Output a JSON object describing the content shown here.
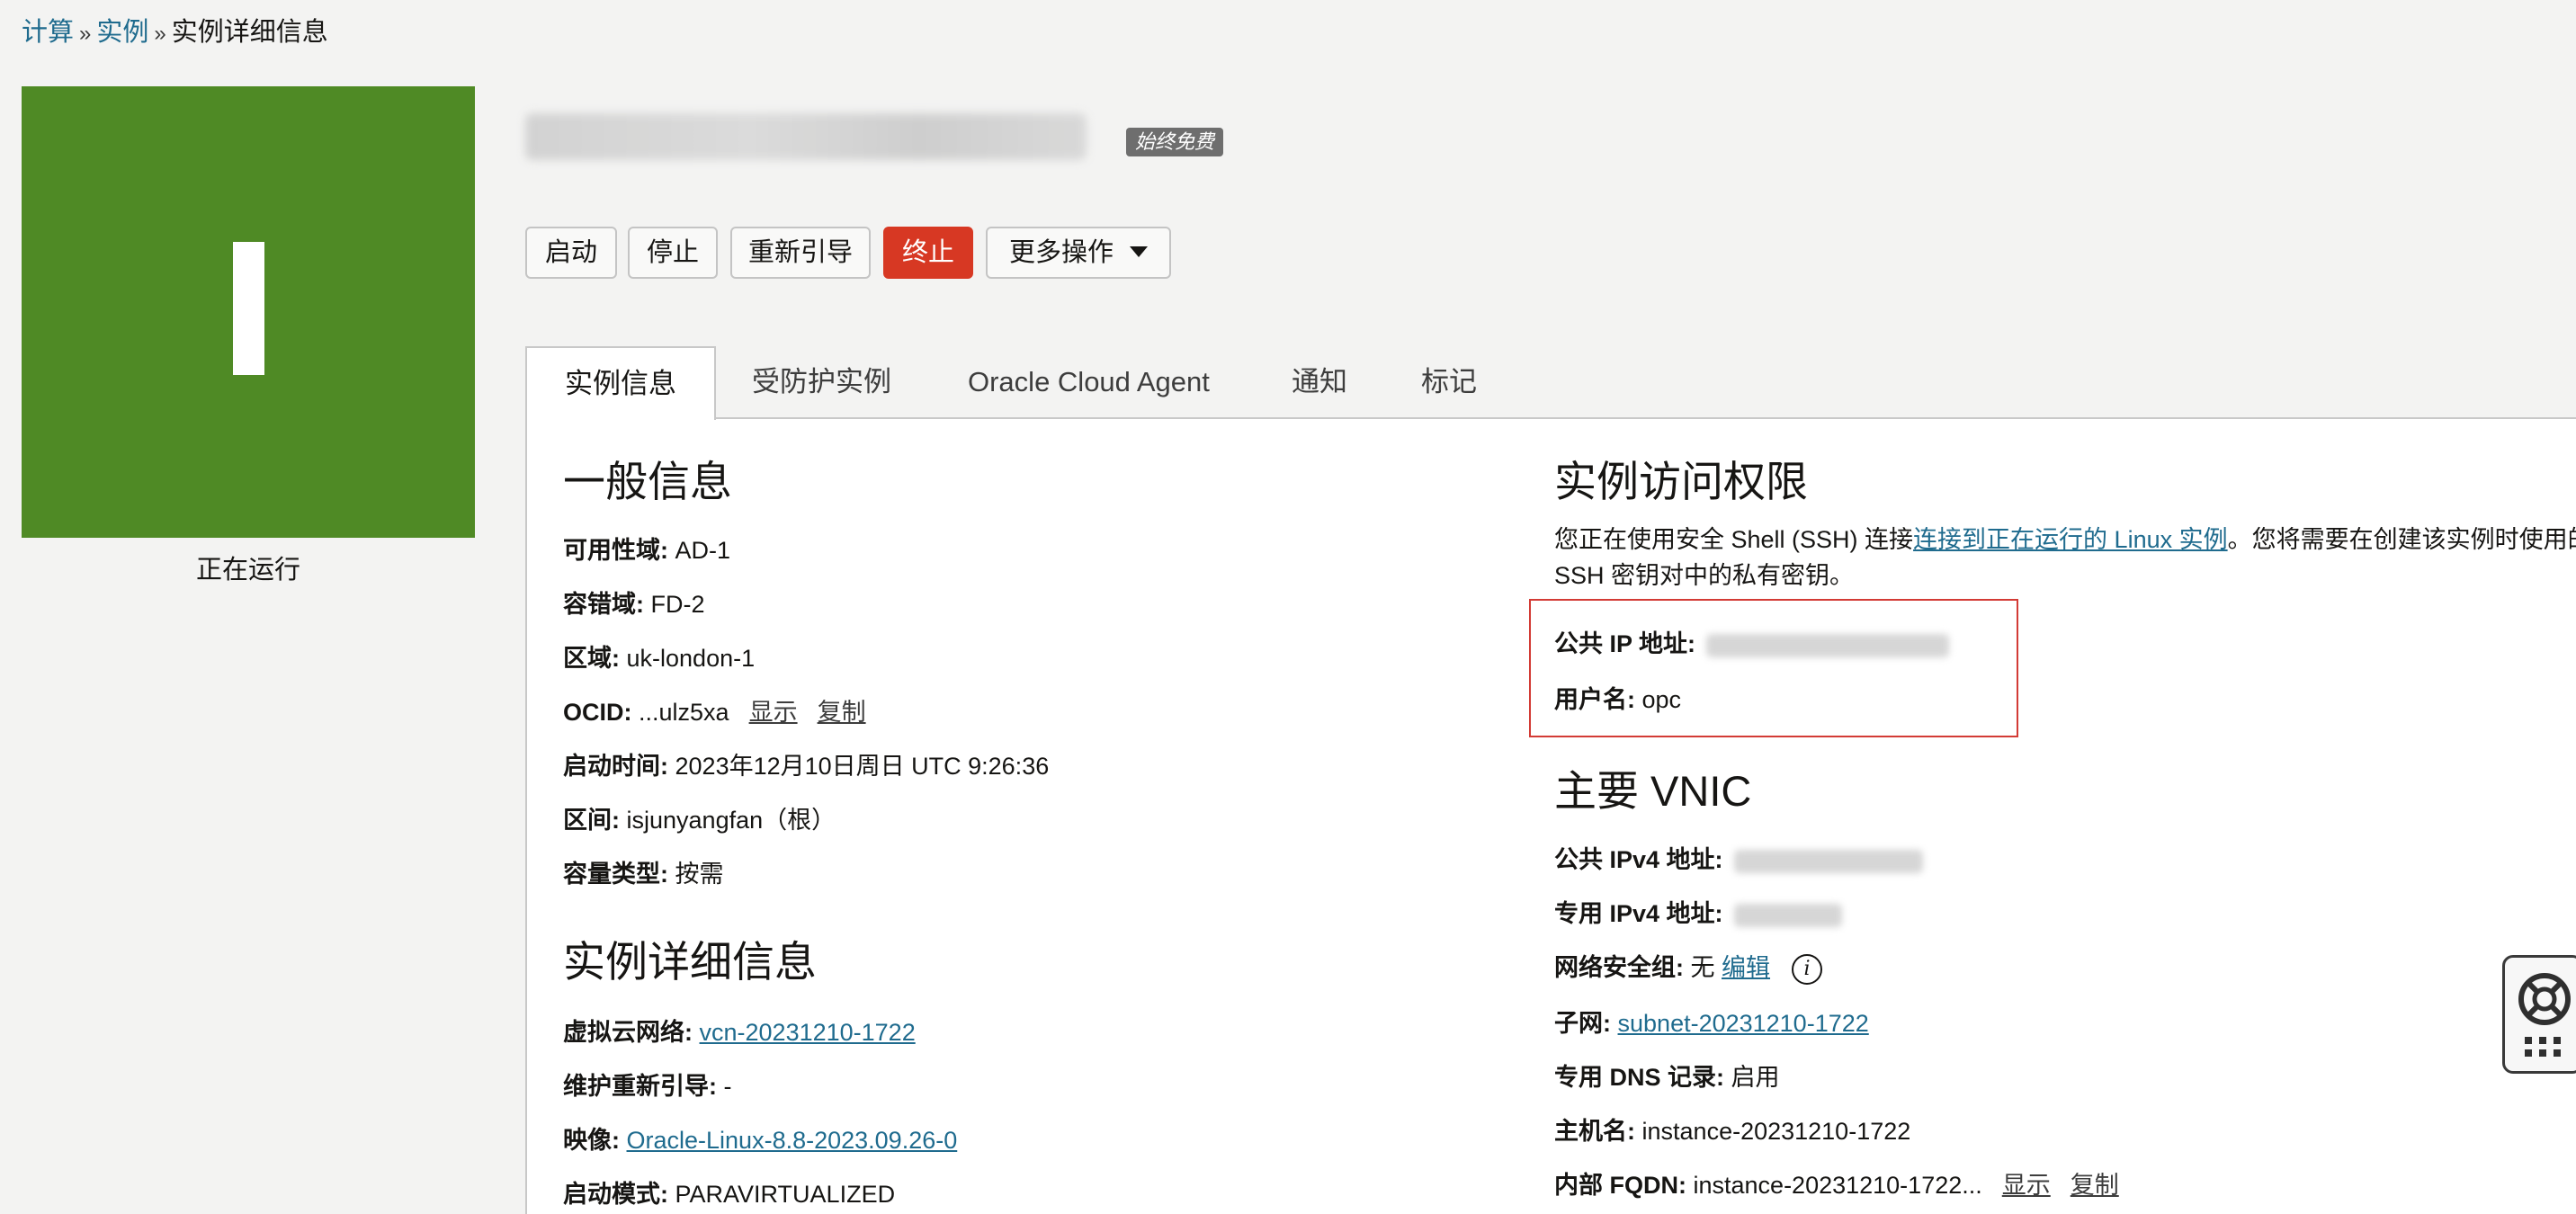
{
  "breadcrumb": {
    "items": [
      "计算",
      "实例",
      "实例详细信息"
    ],
    "separator": "»"
  },
  "status": {
    "letter": "I",
    "label": "正在运行",
    "color": "#4f8a25"
  },
  "header": {
    "badge": "始终免费"
  },
  "actions": {
    "start": "启动",
    "stop": "停止",
    "reboot": "重新引导",
    "terminate": "终止",
    "more": "更多操作"
  },
  "tabs": [
    "实例信息",
    "受防护实例",
    "Oracle Cloud Agent",
    "通知",
    "标记"
  ],
  "general": {
    "heading": "一般信息",
    "ad_label": "可用性域:",
    "ad_value": "AD-1",
    "fd_label": "容错域:",
    "fd_value": "FD-2",
    "region_label": "区域:",
    "region_value": "uk-london-1",
    "ocid_label": "OCID:",
    "ocid_value": "...ulz5xa",
    "ocid_show": "显示",
    "ocid_copy": "复制",
    "launched_label": "启动时间:",
    "launched_value": "2023年12月10日周日 UTC 9:26:36",
    "compartment_label": "区间:",
    "compartment_value": "isjunyangfan（根）",
    "capacity_label": "容量类型:",
    "capacity_value": "按需"
  },
  "details": {
    "heading": "实例详细信息",
    "vcn_label": "虚拟云网络:",
    "vcn_value": "vcn-20231210-1722",
    "maint_label": "维护重新引导:",
    "maint_value": "-",
    "image_label": "映像:",
    "image_value": "Oracle-Linux-8.8-2023.09.26-0",
    "launch_mode_label": "启动模式:",
    "launch_mode_value": "PARAVIRTUALIZED"
  },
  "access": {
    "heading": "实例访问权限",
    "desc_before": "您正在使用安全 Shell (SSH) 连接",
    "desc_link": "连接到正在运行的 Linux 实例",
    "desc_after": "。您将需要在创建该实例时使用的 SSH 密钥对中的私有密钥。",
    "public_ip_label": "公共 IP 地址:",
    "username_label": "用户名:",
    "username_value": "opc"
  },
  "vnic": {
    "heading": "主要 VNIC",
    "public_ipv4_label": "公共 IPv4 地址:",
    "private_ipv4_label": "专用 IPv4 地址:",
    "nsg_label": "网络安全组:",
    "nsg_value": "无",
    "nsg_edit": "编辑",
    "subnet_label": "子网:",
    "subnet_value": "subnet-20231210-1722",
    "dns_label": "专用 DNS 记录:",
    "dns_value": "启用",
    "hostname_label": "主机名:",
    "hostname_value": "instance-20231210-1722",
    "fqdn_label": "内部 FQDN:",
    "fqdn_value": "instance-20231210-1722...",
    "fqdn_show": "显示",
    "fqdn_copy": "复制"
  }
}
